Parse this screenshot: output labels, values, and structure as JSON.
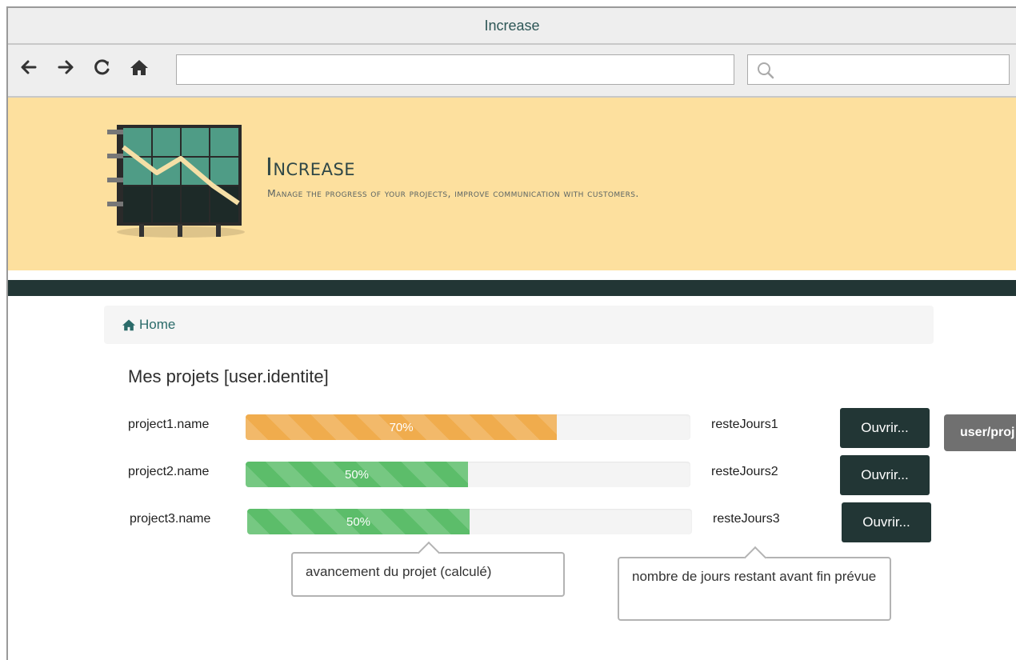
{
  "window": {
    "title": "Increase"
  },
  "browser": {
    "address_value": "",
    "search_value": ""
  },
  "brand": {
    "title": "Increase",
    "subtitle": "Manage the progress of your projects, improve communication with customers."
  },
  "breadcrumb": {
    "home_label": "Home"
  },
  "page": {
    "title": "Mes projets [user.identite]"
  },
  "projects": [
    {
      "name": "project1.name",
      "progress": 70,
      "progress_label": "70%",
      "color": "#f0ac4d",
      "days": "resteJours1",
      "open_label": "Ouvrir..."
    },
    {
      "name": "project2.name",
      "progress": 50,
      "progress_label": "50%",
      "color": "#5cbd6a",
      "days": "resteJours2",
      "open_label": "Ouvrir..."
    },
    {
      "name": "project3.name",
      "progress": 50,
      "progress_label": "50%",
      "color": "#5cbd6a",
      "days": "resteJours3",
      "open_label": "Ouvrir..."
    }
  ],
  "annotations": {
    "button_tooltip": "user/proj",
    "progress_note": "avancement du projet (calculé)",
    "days_note": "nombre de jours restant avant fin prévue"
  },
  "colors": {
    "banner": "#fde09e",
    "dark": "#223635",
    "progress_orange": "#f0ac4d",
    "progress_green": "#5cbd6a"
  }
}
